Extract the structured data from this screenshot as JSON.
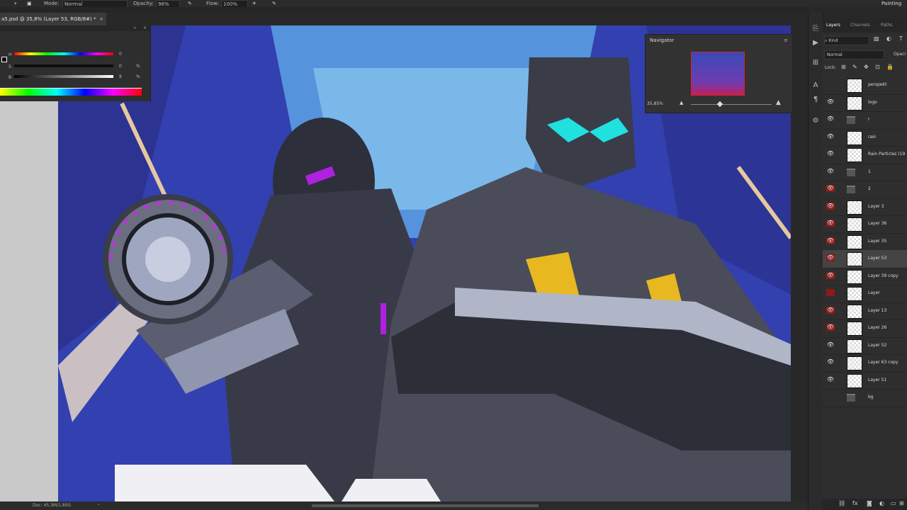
{
  "options_bar": {
    "mode_label": "Mode:",
    "mode_value": "Normal",
    "opacity_label": "Opacity:",
    "opacity_value": "96%",
    "flow_label": "Flow:",
    "flow_value": "100%",
    "workspace": "Painting"
  },
  "document": {
    "tab_title": "a5.psd @ 35,8% (Layer 53, RGB/8#) *",
    "close": "×",
    "status": "Doc: 45,3M/1,80G"
  },
  "color_panel": {
    "sliders": [
      {
        "label": "H",
        "value": "0",
        "unit": ""
      },
      {
        "label": "S",
        "value": "0",
        "unit": "%"
      },
      {
        "label": "B",
        "value": "8",
        "unit": "%"
      }
    ]
  },
  "navigator": {
    "title": "Navigator",
    "zoom": "35,85%",
    "view_fraction": 0.36
  },
  "layers_panel": {
    "tabs": [
      "Layers",
      "Channels",
      "Paths"
    ],
    "filter_label": "Kind",
    "blend_mode": "Normal",
    "opacity_label": "Opaci",
    "lock_label": "Lock:",
    "layers": [
      {
        "name": "perspekt",
        "visible": false,
        "type": "layer",
        "color": ""
      },
      {
        "name": "logo",
        "visible": true,
        "type": "layer",
        "color": ""
      },
      {
        "name": "r",
        "visible": true,
        "type": "group",
        "color": ""
      },
      {
        "name": "rain",
        "visible": true,
        "type": "layer",
        "color": ""
      },
      {
        "name": "Rain Particles (19",
        "visible": true,
        "type": "layer",
        "color": ""
      },
      {
        "name": "1",
        "visible": true,
        "type": "group",
        "color": ""
      },
      {
        "name": "2",
        "visible": true,
        "type": "group",
        "color": "red"
      },
      {
        "name": "Layer 3",
        "visible": true,
        "type": "layer",
        "color": "red"
      },
      {
        "name": "Layer 36",
        "visible": true,
        "type": "layer",
        "color": "red"
      },
      {
        "name": "Layer 35",
        "visible": true,
        "type": "layer",
        "color": "red"
      },
      {
        "name": "Layer 53",
        "visible": true,
        "type": "layer",
        "color": "red"
      },
      {
        "name": "Layer 39 copy",
        "visible": true,
        "type": "layer",
        "color": "red"
      },
      {
        "name": "Layer",
        "visible": false,
        "type": "layer",
        "color": "red"
      },
      {
        "name": "Layer 13",
        "visible": true,
        "type": "layer",
        "color": "red"
      },
      {
        "name": "Layer 26",
        "visible": true,
        "type": "layer",
        "color": "red"
      },
      {
        "name": "Layer 52",
        "visible": true,
        "type": "layer",
        "color": ""
      },
      {
        "name": "Layer 63 copy",
        "visible": true,
        "type": "layer",
        "color": ""
      },
      {
        "name": "Layer 51",
        "visible": true,
        "type": "layer",
        "color": ""
      },
      {
        "name": "bg",
        "visible": false,
        "type": "group",
        "color": ""
      }
    ]
  }
}
